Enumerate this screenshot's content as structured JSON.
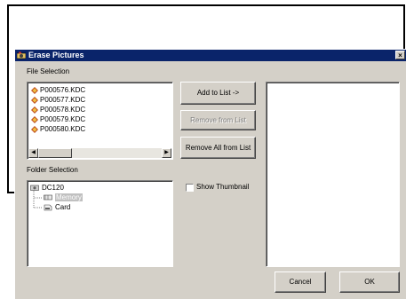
{
  "dialog": {
    "title": "Erase Pictures",
    "close_label": "×"
  },
  "file_selection": {
    "label": "File Selection",
    "files": [
      "P000576.KDC",
      "P000577.KDC",
      "P000578.KDC",
      "P000579.KDC",
      "P000580.KDC"
    ],
    "scroll_left": "◀",
    "scroll_right": "▶"
  },
  "folder_selection": {
    "label": "Folder Selection",
    "root": "DC120",
    "children": [
      {
        "label": "Memory",
        "selected": true
      },
      {
        "label": "Card",
        "selected": false
      }
    ]
  },
  "actions": {
    "add_label": "Add to List ->",
    "remove_label": "Remove from List",
    "remove_all_label": "Remove All from List"
  },
  "show_thumbnail": {
    "label": "Show Thumbnail",
    "checked": false
  },
  "footer": {
    "cancel_label": "Cancel",
    "ok_label": "OK"
  },
  "colors": {
    "titlebar": "#0a246a",
    "dialog_face": "#d4d0c8"
  }
}
